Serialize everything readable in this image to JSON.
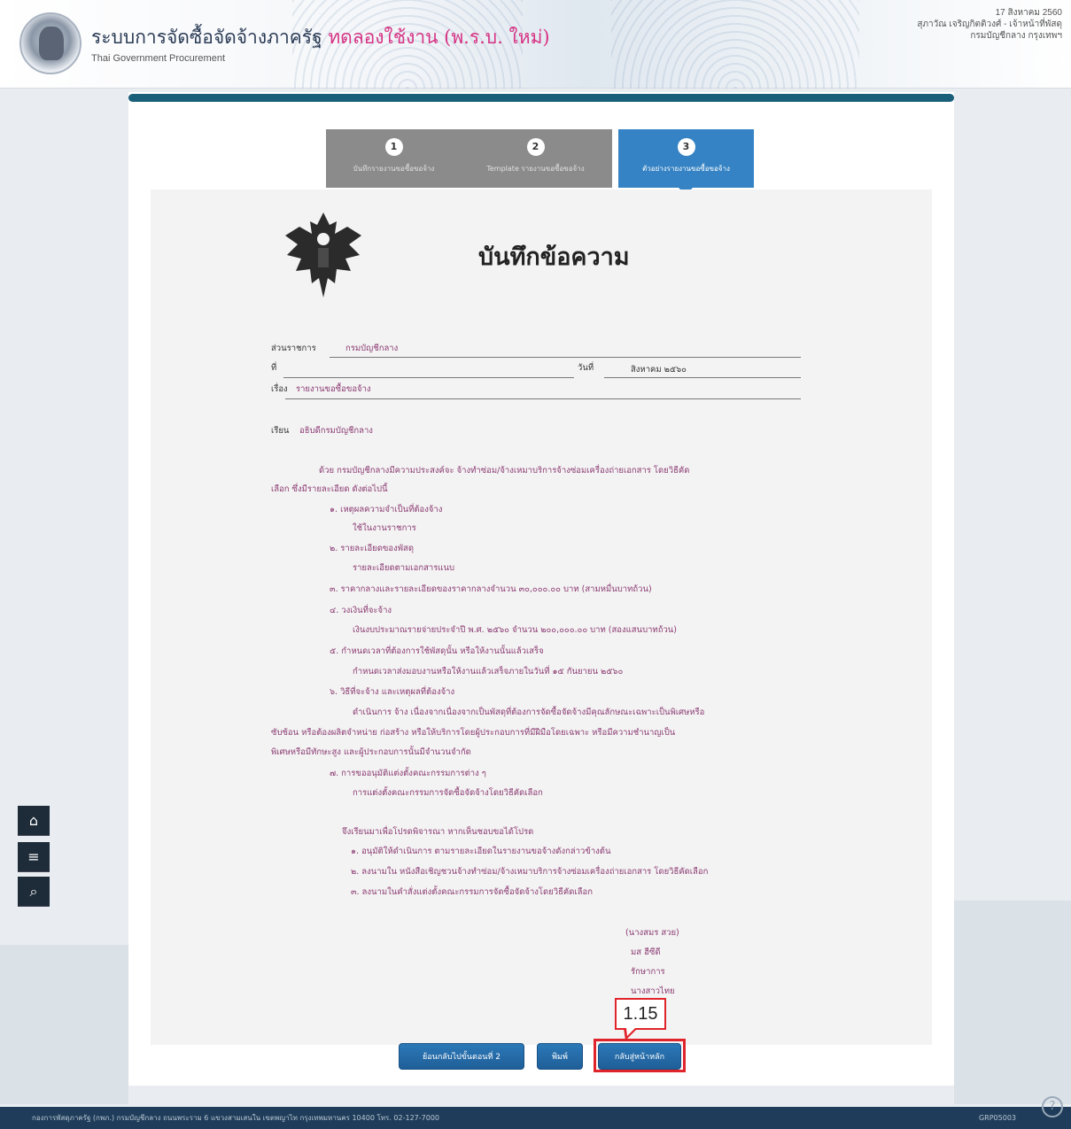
{
  "header": {
    "title": "ระบบการจัดซื้อจัดจ้างภาครัฐ",
    "trial_label": "ทดลองใช้งาน (พ.ร.บ. ใหม่)",
    "subtitle": "Thai Government Procurement",
    "date": "17 สิงหาคม 2560",
    "user": "สุภาวัณ เจริญกิตติวงศ์ - เจ้าหน้าที่พัสดุ",
    "department": "กรมบัญชีกลาง กรุงเทพฯ"
  },
  "steps": [
    {
      "num": "1",
      "label": "บันทึกรายงานขอซื้อขอจ้าง"
    },
    {
      "num": "2",
      "label": "Template รายงานขอซื้อขอจ้าง"
    },
    {
      "num": "3",
      "label": "ตัวอย่างรายงานขอซื้อขอจ้าง"
    }
  ],
  "document": {
    "title": "บันทึกข้อความ",
    "agency_label": "ส่วนราชการ",
    "agency_value": "กรมบัญชีกลาง",
    "ref_label": "ที่",
    "date_label": "วันที่",
    "date_value": "สิงหาคม ๒๕๖๐",
    "subject_label": "เรื่อง",
    "subject_value": "รายงานขอซื้อขอจ้าง",
    "to_label": "เรียน",
    "to_value": "อธิบดีกรมบัญชีกลาง",
    "intro_1": "ด้วย กรมบัญชีกลางมีความประสงค์จะ จ้างทำซ่อม/จ้างเหมาบริการจ้างซ่อมเครื่องถ่ายเอกสาร โดยวิธีคัด",
    "intro_2": "เลือก ซึ่งมีรายละเอียด ดังต่อไปนี้",
    "items": [
      {
        "head": "๑. เหตุผลความจำเป็นที่ต้องจ้าง",
        "body": "ใช้ในงานราชการ"
      },
      {
        "head": "๒. รายละเอียดของพัสดุ",
        "body": "รายละเอียดตามเอกสารแนบ"
      },
      {
        "head": "๓. ราคากลางและรายละเอียดของราคากลางจำนวน ๓๐,๐๐๐.๐๐ บาท (สามหมื่นบาทถ้วน)",
        "body": ""
      },
      {
        "head": "๔. วงเงินที่จะจ้าง",
        "body": "เงินงบประมาณรายจ่ายประจำปี พ.ศ. ๒๕๖๐ จำนวน ๒๐๐,๐๐๐.๐๐ บาท (สองแสนบาทถ้วน)"
      },
      {
        "head": "๕. กำหนดเวลาที่ต้องการใช้พัสดุนั้น หรือให้งานนั้นแล้วเสร็จ",
        "body": "กำหนดเวลาส่งมอบงานหรือให้งานแล้วเสร็จภายในวันที่ ๑๕ กันยายน ๒๕๖๐"
      },
      {
        "head": "๖. วิธีที่จะจ้าง และเหตุผลที่ต้องจ้าง",
        "body": "ดำเนินการ จ้าง เนื่องจากเนื่องจากเป็นพัสดุที่ต้องการจัดซื้อจัดจ้างมีคุณลักษณะเฉพาะเป็นพิเศษหรือ"
      }
    ],
    "reason_2": "ซับซ้อน หรือต้องผลิตจำหน่าย ก่อสร้าง หรือให้บริการโดยผู้ประกอบการที่มีฝีมือโดยเฉพาะ หรือมีความชำนาญเป็น",
    "reason_3": "พิเศษหรือมีทักษะสูง และผู้ประกอบการนั้นมีจำนวนจำกัด",
    "item7_head": "๗. การขออนุมัติแต่งตั้งคณะกรรมการต่าง ๆ",
    "item7_body": "การแต่งตั้งคณะกรรมการจัดซื้อจัดจ้างโดยวิธีคัดเลือก",
    "request": "จึงเรียนมาเพื่อโปรดพิจารณา หากเห็นชอบขอได้โปรด",
    "approvals": [
      "๑. อนุมัติให้ดำเนินการ ตามรายละเอียดในรายงานขอจ้างดังกล่าวข้างต้น",
      "๒. ลงนามใน หนังสือเชิญชวนจ้างทำซ่อม/จ้างเหมาบริการจ้างซ่อมเครื่องถ่ายเอกสาร โดยวิธีคัดเลือก",
      "๓. ลงนามในคำสั่งแต่งตั้งคณะกรรมการจัดซื้อจัดจ้างโดยวิธีคัดเลือก"
    ],
    "signer_name": "(นางสมร สวย)",
    "signer_code": "มส ฮีซีดี",
    "signer_role": "รักษาการ",
    "signer_extra": "นางสาวไทย"
  },
  "buttons": {
    "back": "ย้อนกลับไปขั้นตอนที่ 2",
    "print": "พิมพ์",
    "main": "กลับสู่หน้าหลัก"
  },
  "annotation": {
    "callout": "1.15"
  },
  "tools": {
    "home": "⌂",
    "menu": "≡",
    "search": "⌕"
  },
  "footer": {
    "address": "กองการพัสดุภาครัฐ (กพภ.) กรมบัญชีกลาง ถนนพระราม 6 แขวงสามเสนใน เขตพญาไท กรุงเทพมหานคร 10400 โทร. 02-127-7000",
    "code": "GRP05003",
    "help": "?"
  }
}
